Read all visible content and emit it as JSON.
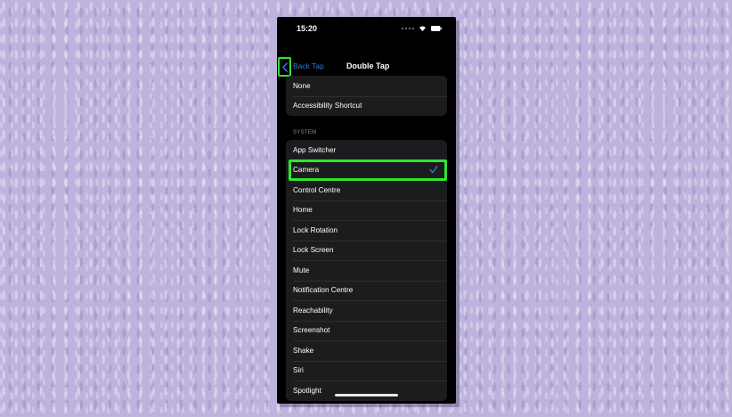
{
  "status_bar": {
    "time": "15:20"
  },
  "nav": {
    "back_label": "Back Tap",
    "title": "Double Tap"
  },
  "group1": {
    "items": [
      "None",
      "Accessibility Shortcut"
    ]
  },
  "system_section": {
    "header": "SYSTEM"
  },
  "group2": {
    "items": [
      "App Switcher",
      "Camera",
      "Control Centre",
      "Home",
      "Lock Rotation",
      "Lock Screen",
      "Mute",
      "Notification Centre",
      "Reachability",
      "Screenshot",
      "Shake",
      "Siri",
      "Spotlight"
    ],
    "selected": "Camera"
  },
  "colors": {
    "highlight": "#2ee62e",
    "accent": "#2f7bd8"
  }
}
